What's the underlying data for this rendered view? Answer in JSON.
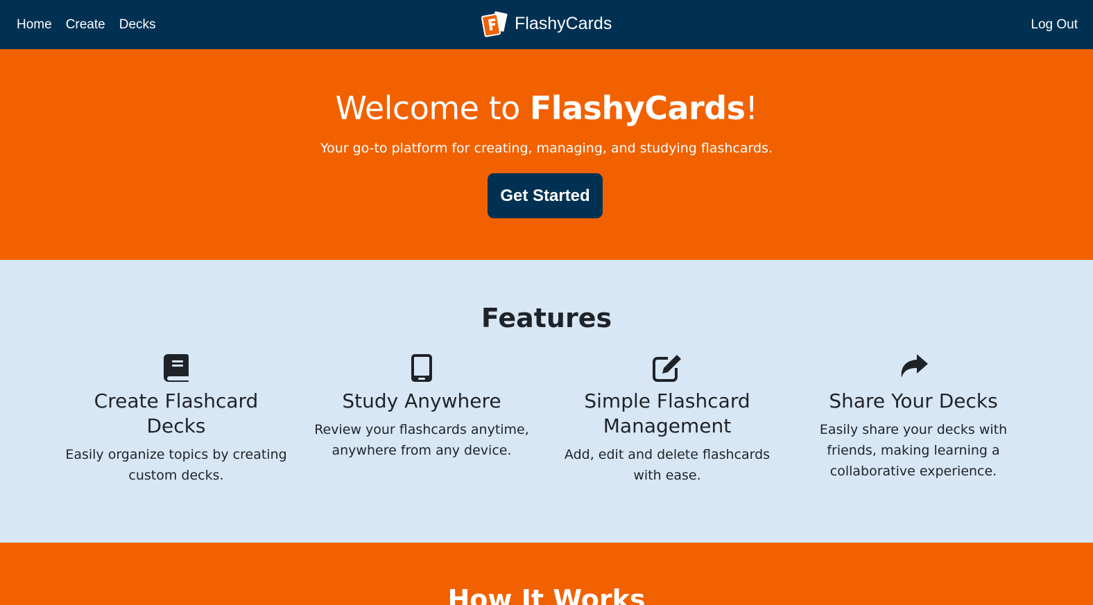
{
  "nav": {
    "links": [
      "Home",
      "Create",
      "Decks"
    ],
    "brand": "FlashyCards",
    "logout": "Log Out"
  },
  "hero": {
    "title_prefix": "Welcome to ",
    "title_brand": "FlashyCards",
    "title_suffix": "!",
    "subtitle": "Your go-to platform for creating, managing, and studying flashcards.",
    "cta": "Get Started"
  },
  "features": {
    "heading": "Features",
    "items": [
      {
        "icon": "book-icon",
        "title": "Create Flashcard Decks",
        "desc": "Easily organize topics by creating custom decks."
      },
      {
        "icon": "mobile-phone-icon",
        "title": "Study Anywhere",
        "desc": "Review your flashcards anytime, anywhere from any device."
      },
      {
        "icon": "edit-icon",
        "title": "Simple Flashcard Management",
        "desc": "Add, edit and delete flashcards with ease."
      },
      {
        "icon": "share-icon",
        "title": "Share Your Decks",
        "desc": "Easily share your decks with friends, making learning a collaborative experience."
      }
    ]
  },
  "how": {
    "heading": "How It Works"
  },
  "colors": {
    "navy": "#003153",
    "orange": "#f26100",
    "light_blue": "#d7e7f5",
    "text_dark": "#1f2328"
  }
}
